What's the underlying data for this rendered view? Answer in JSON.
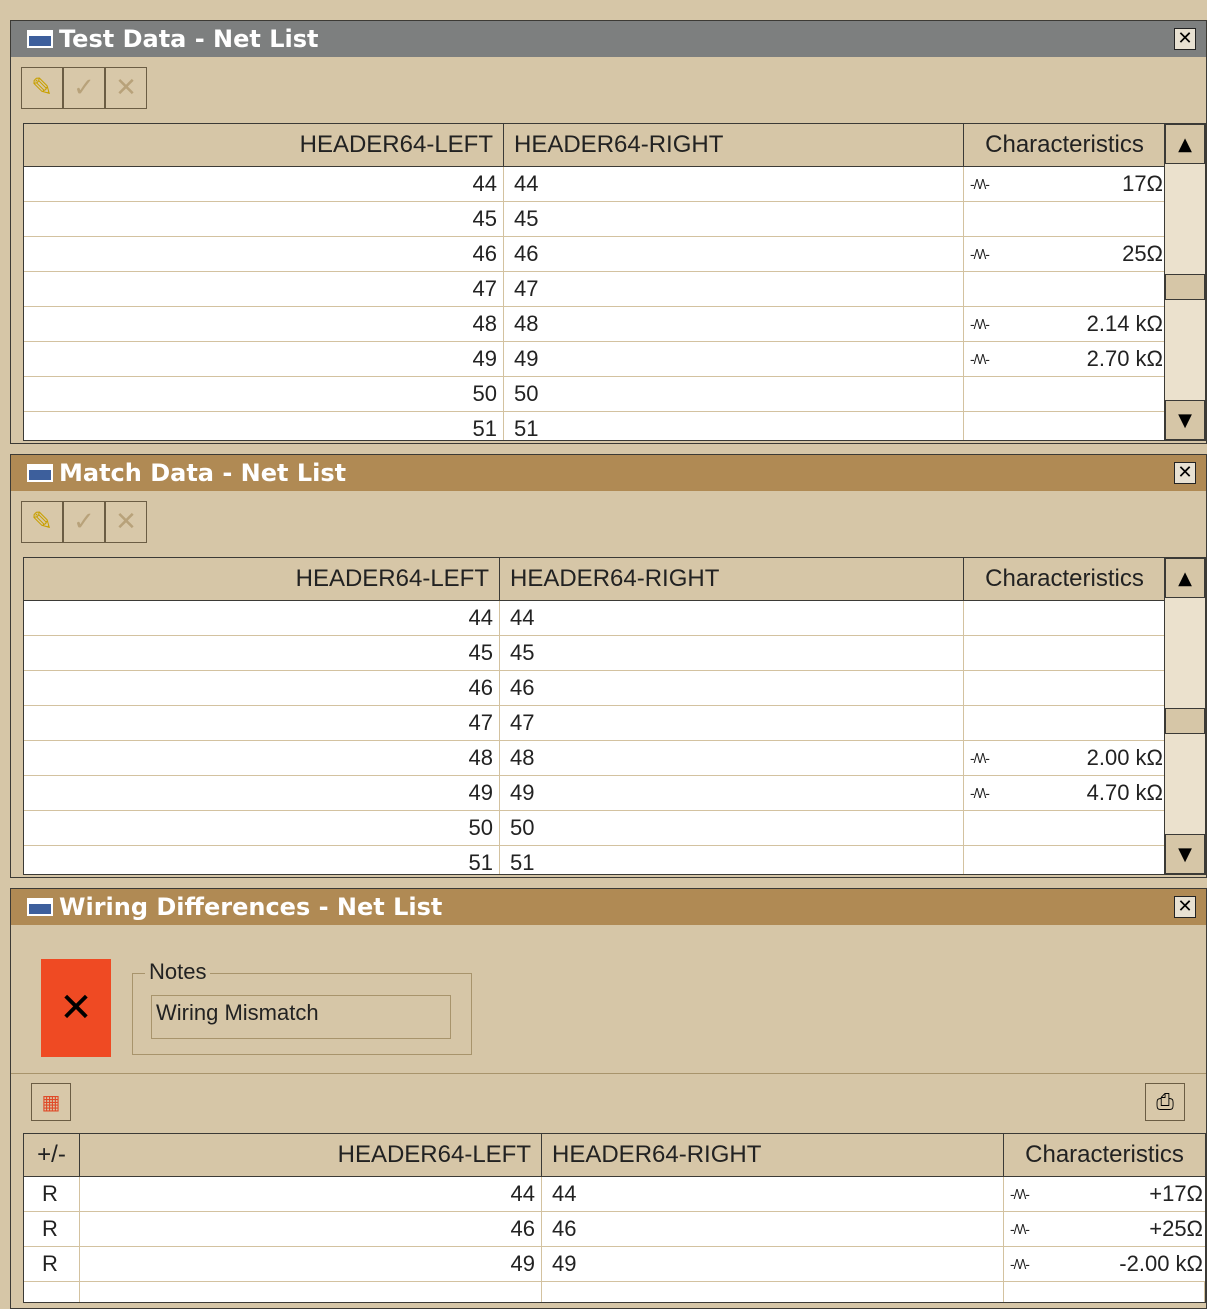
{
  "test_panel": {
    "title": "Test Data - Net List",
    "columns": [
      "HEADER64-LEFT",
      "HEADER64-RIGHT",
      "Characteristics"
    ],
    "rows": [
      {
        "left": "44",
        "right": "44",
        "res": true,
        "value": "17Ω"
      },
      {
        "left": "45",
        "right": "45",
        "res": false,
        "value": ""
      },
      {
        "left": "46",
        "right": "46",
        "res": true,
        "value": "25Ω"
      },
      {
        "left": "47",
        "right": "47",
        "res": false,
        "value": ""
      },
      {
        "left": "48",
        "right": "48",
        "res": true,
        "value": "2.14 kΩ"
      },
      {
        "left": "49",
        "right": "49",
        "res": true,
        "value": "2.70 kΩ"
      },
      {
        "left": "50",
        "right": "50",
        "res": false,
        "value": ""
      },
      {
        "left": "51",
        "right": "51",
        "res": false,
        "value": ""
      }
    ]
  },
  "match_panel": {
    "title": "Match Data - Net List",
    "columns": [
      "HEADER64-LEFT",
      "HEADER64-RIGHT",
      "Characteristics"
    ],
    "rows": [
      {
        "left": "44",
        "right": "44",
        "res": false,
        "value": ""
      },
      {
        "left": "45",
        "right": "45",
        "res": false,
        "value": ""
      },
      {
        "left": "46",
        "right": "46",
        "res": false,
        "value": ""
      },
      {
        "left": "47",
        "right": "47",
        "res": false,
        "value": ""
      },
      {
        "left": "48",
        "right": "48",
        "res": true,
        "value": "2.00 kΩ"
      },
      {
        "left": "49",
        "right": "49",
        "res": true,
        "value": "4.70 kΩ"
      },
      {
        "left": "50",
        "right": "50",
        "res": false,
        "value": ""
      },
      {
        "left": "51",
        "right": "51",
        "res": false,
        "value": ""
      }
    ]
  },
  "diff_panel": {
    "title": "Wiring Differences - Net List",
    "status_symbol": "✕",
    "notes_label": "Notes",
    "notes_value": "Wiring Mismatch",
    "columns": [
      "+/-",
      "HEADER64-LEFT",
      "HEADER64-RIGHT",
      "Characteristics"
    ],
    "rows": [
      {
        "flag": "R",
        "left": "44",
        "right": "44",
        "value": "+17Ω"
      },
      {
        "flag": "R",
        "left": "46",
        "right": "46",
        "value": "+25Ω"
      },
      {
        "flag": "R",
        "left": "49",
        "right": "49",
        "value": "-2.00 kΩ"
      }
    ]
  },
  "icons": {
    "close": "✕",
    "edit": "✎",
    "accept": "✓",
    "reject": "✕",
    "scroll_up": "▲",
    "scroll_down": "▼",
    "resistor": "-/\\/\\-",
    "print": "⎙",
    "compare": "▦"
  },
  "colors": {
    "background": "#d6c6a7",
    "title_gray": "#7d7f7f",
    "title_brown": "#b08a54",
    "status_error": "#ef4a23"
  }
}
